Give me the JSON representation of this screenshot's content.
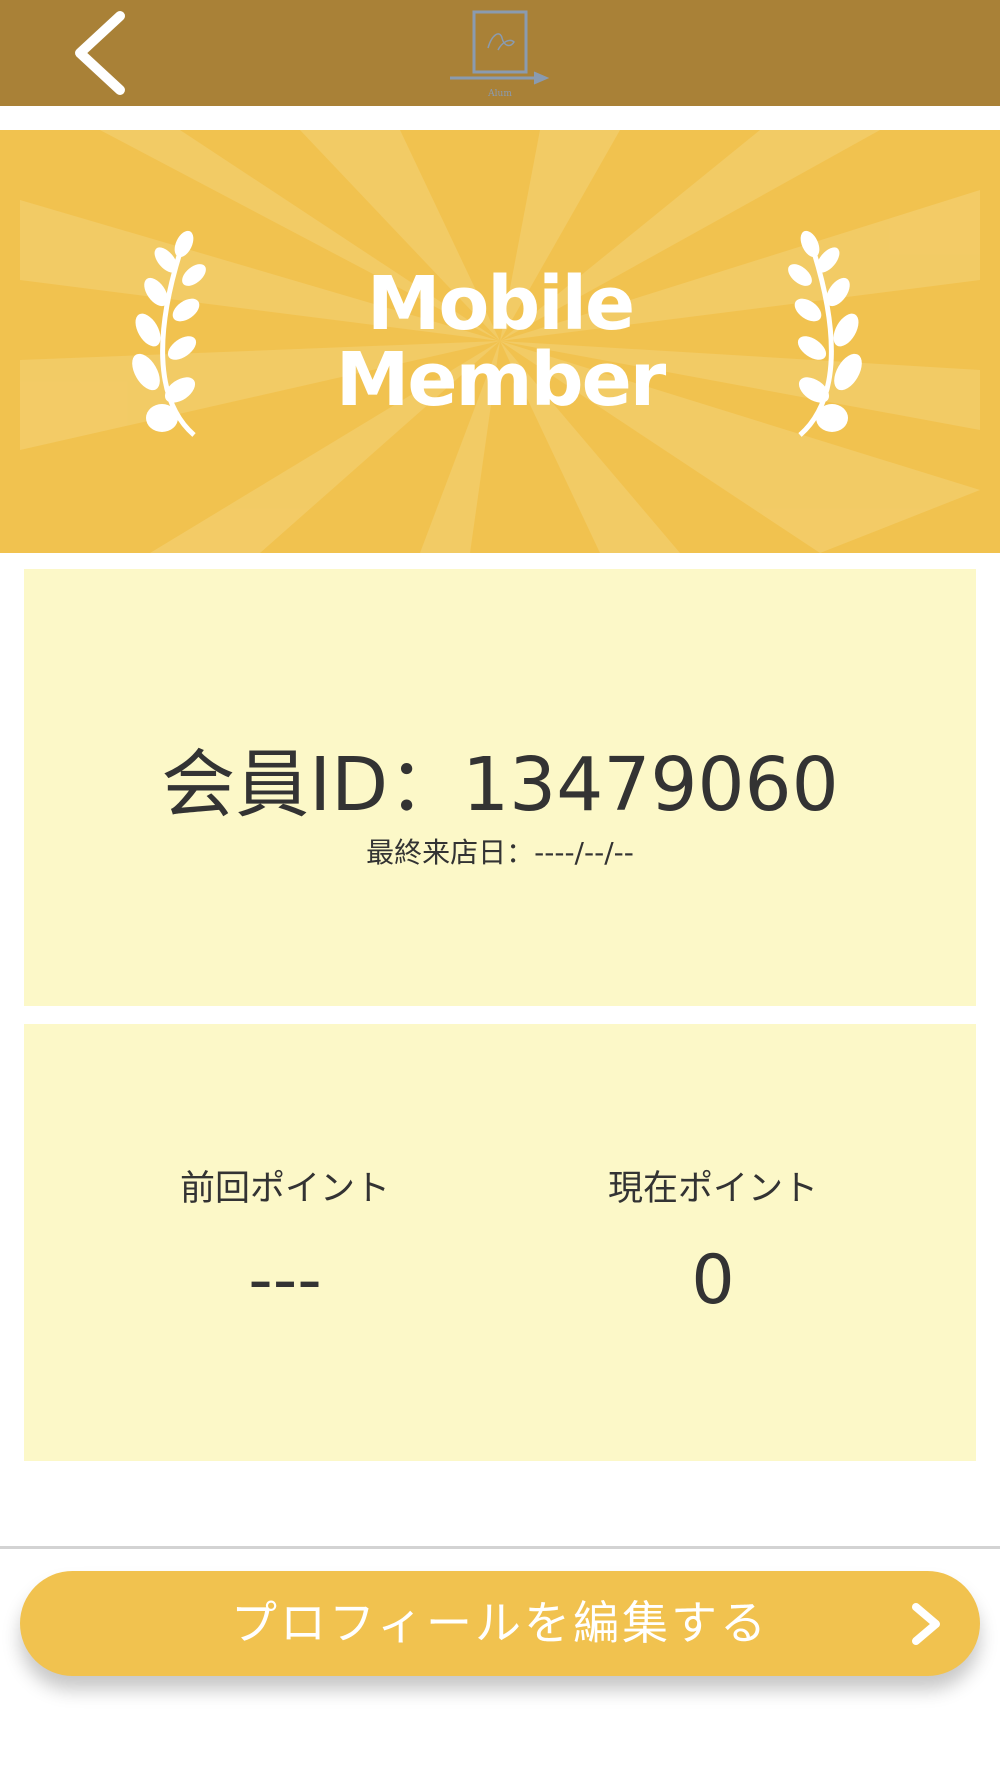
{
  "header": {
    "back_icon": "chevron-left-icon",
    "logo_icon": "laptop-logo-icon",
    "logo_text": "Alum"
  },
  "hero": {
    "title_line1": "Mobile",
    "title_line2": "Member",
    "decoration_icon": "laurel-branch-icon"
  },
  "member": {
    "id_text": "会員ID：13479060",
    "last_visit_text": "最終来店日：----/--/--"
  },
  "points": {
    "previous_label": "前回ポイント",
    "previous_value": "---",
    "current_label": "現在ポイント",
    "current_value": "0"
  },
  "actions": {
    "edit_profile_label": "プロフィールを編集する",
    "edit_profile_icon": "chevron-right-icon"
  },
  "colors": {
    "header_bg": "#a98137",
    "accent": "#f1c24f",
    "card_bg": "#fcf8c8",
    "text": "#333333"
  }
}
